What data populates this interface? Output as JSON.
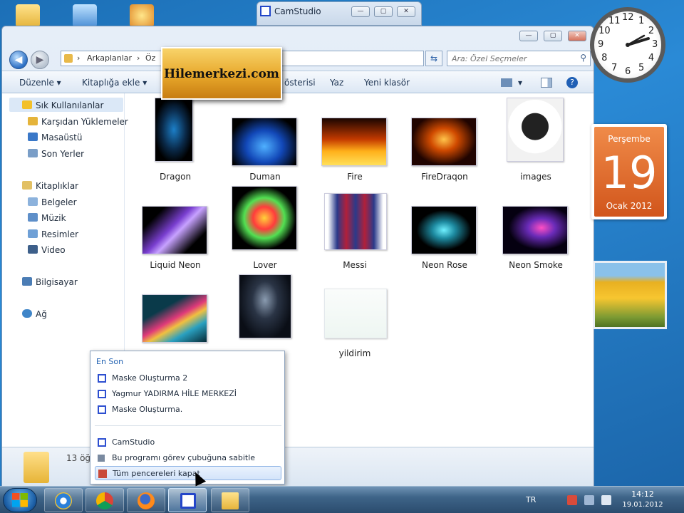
{
  "cam_window": {
    "title": "CamStudio",
    "min": "—",
    "max": "▢",
    "close": "✕"
  },
  "explorer": {
    "controls": {
      "min": "—",
      "max": "▢",
      "close": "✕"
    },
    "address": {
      "part1": "Arkaplanlar",
      "sep": "›",
      "part2": "Öz"
    },
    "search": {
      "placeholder": "Ara: Özel Seçmeler"
    },
    "toolbar": {
      "organize": "Düzenle ▾",
      "add_library": "Kitaplığa ekle ▾",
      "slideshow": "österisi",
      "burn": "Yaz",
      "new_folder": "Yeni klasör"
    },
    "nav": {
      "favorites": "Sık Kullanılanlar",
      "downloads": "Karşıdan Yüklemeler",
      "desktop": "Masaüstü",
      "recent": "Son Yerler",
      "libraries": "Kitaplıklar",
      "documents": "Belgeler",
      "music": "Müzik",
      "pictures": "Resimler",
      "video": "Video",
      "computer": "Bilgisayar",
      "network": "Ağ"
    },
    "files": [
      {
        "name": "Dragon"
      },
      {
        "name": "Duman"
      },
      {
        "name": "Fire"
      },
      {
        "name": "FireDraqon"
      },
      {
        "name": "images"
      },
      {
        "name": "Liquid Neon"
      },
      {
        "name": "Lover"
      },
      {
        "name": "Messi"
      },
      {
        "name": "Neon Rose"
      },
      {
        "name": "Neon Smoke"
      },
      {
        "name": "yildirim"
      }
    ],
    "details": {
      "count": "13 öğ"
    }
  },
  "watermark": {
    "text": "Hilemerkezi.com"
  },
  "jumplist": {
    "header": "En Son",
    "recent": [
      "Maske Oluşturma 2",
      "Yagmur YADIRMA HİLE MERKEZİ",
      "Maske Oluşturma."
    ],
    "app": "CamStudio",
    "pin": "Bu programı görev çubuğuna sabitle",
    "close_all": "Tüm pencereleri kapat"
  },
  "gadgets": {
    "clock_numbers": [
      "12",
      "1",
      "2",
      "3",
      "4",
      "5",
      "6",
      "7",
      "8",
      "9",
      "10",
      "11"
    ],
    "calendar": {
      "weekday": "Perşembe",
      "day": "19",
      "month_year": "Ocak 2012"
    }
  },
  "taskbar": {
    "lang": "TR",
    "time": "14:12",
    "date": "19.01.2012"
  },
  "colors": {
    "accent": "#2a8ad6",
    "calendar": "#e06a2b",
    "watermark": "#e7a72a"
  }
}
